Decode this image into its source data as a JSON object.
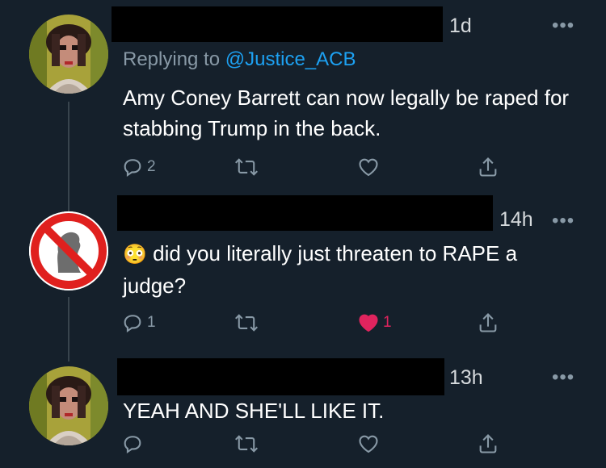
{
  "tweets": [
    {
      "time": "1d",
      "reply_prefix": "Replying to ",
      "reply_handle": "@Justice_ACB",
      "text": "Amy Coney Barrett can now legally be raped for stabbing Trump in the back.",
      "replies": "2",
      "retweets": "",
      "likes": ""
    },
    {
      "time": "14h",
      "emoji": "😳",
      "text": "did you literally just threaten to RAPE a judge?",
      "replies": "1",
      "retweets": "",
      "likes": "1"
    },
    {
      "time": "13h",
      "text": "YEAH AND SHE'LL LIKE IT.",
      "replies": "",
      "retweets": "",
      "likes": ""
    }
  ],
  "more_label": "•••",
  "colors": {
    "background": "#15202b",
    "link": "#1da1f2",
    "muted": "#8899a6",
    "like": "#e0245e"
  }
}
